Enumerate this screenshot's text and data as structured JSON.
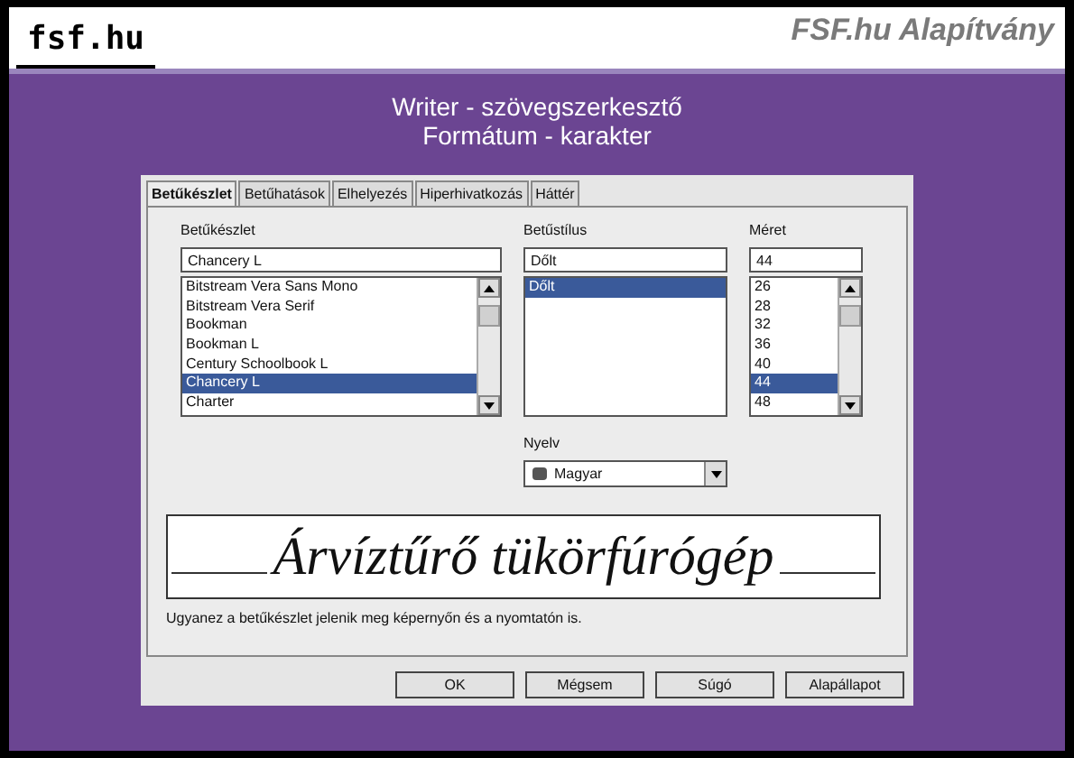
{
  "header": {
    "logo": "fsf.hu",
    "org": "FSF.hu Alapítvány"
  },
  "title_lines": [
    "Writer - szövegszerkesztő",
    "Formátum - karakter"
  ],
  "dialog": {
    "tabs": [
      {
        "label": "Betűkészlet",
        "selected": true
      },
      {
        "label": "Betűhatások",
        "selected": false
      },
      {
        "label": "Elhelyezés",
        "selected": false
      },
      {
        "label": "Hiperhivatkozás",
        "selected": false
      },
      {
        "label": "Háttér",
        "selected": false
      }
    ],
    "font": {
      "label": "Betűkészlet",
      "value": "Chancery L",
      "items": [
        {
          "text": "Bitstream Vera Sans Mono",
          "selected": false
        },
        {
          "text": "Bitstream Vera Serif",
          "selected": false
        },
        {
          "text": "Bookman",
          "selected": false
        },
        {
          "text": "Bookman L",
          "selected": false
        },
        {
          "text": "Century Schoolbook L",
          "selected": false
        },
        {
          "text": "Chancery L",
          "selected": true
        },
        {
          "text": "Charter",
          "selected": false
        }
      ]
    },
    "style": {
      "label": "Betűstílus",
      "value": "Dőlt",
      "items": [
        {
          "text": "Dőlt",
          "selected": true
        }
      ]
    },
    "size": {
      "label": "Méret",
      "value": "44",
      "items": [
        {
          "text": "26",
          "selected": false
        },
        {
          "text": "28",
          "selected": false
        },
        {
          "text": "32",
          "selected": false
        },
        {
          "text": "36",
          "selected": false
        },
        {
          "text": "40",
          "selected": false
        },
        {
          "text": "44",
          "selected": true
        },
        {
          "text": "48",
          "selected": false
        }
      ]
    },
    "language": {
      "label": "Nyelv",
      "value": "Magyar"
    },
    "preview": "Árvíztűrő tükörfúrógép",
    "note": "Ugyanez a betűkészlet jelenik meg képernyőn és a nyomtatón is.",
    "buttons": [
      "OK",
      "Mégsem",
      "Súgó",
      "Alapállapot"
    ]
  }
}
